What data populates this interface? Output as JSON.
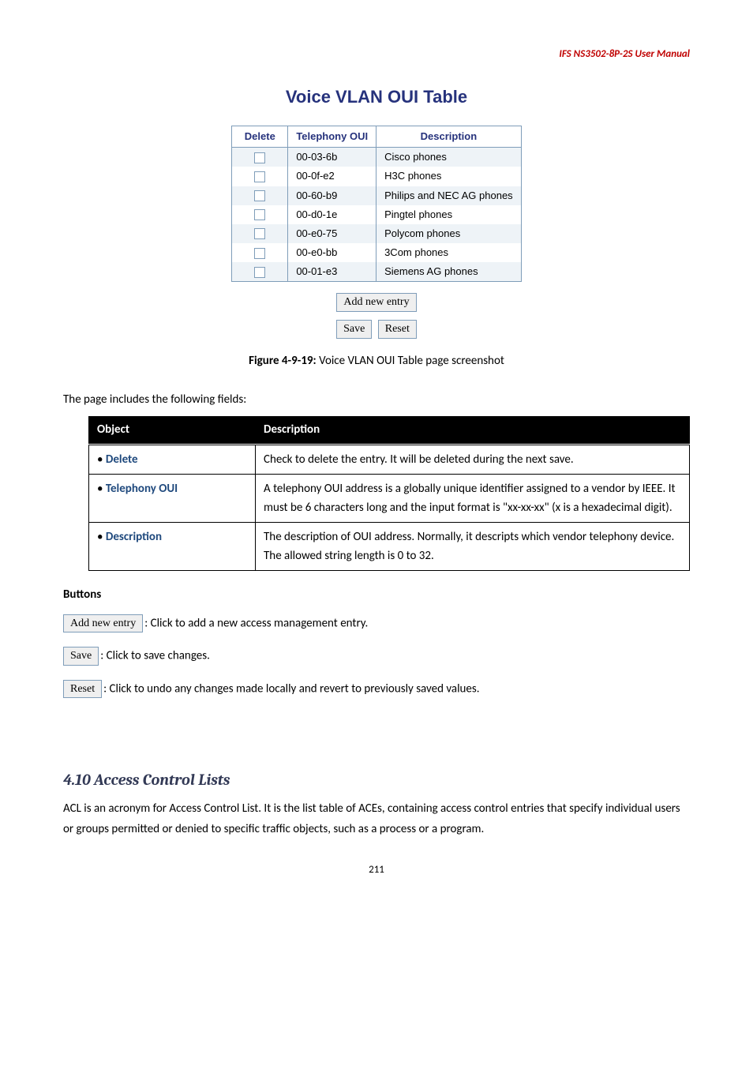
{
  "header": {
    "title": "IFS  NS3502-8P-2S  User  Manual"
  },
  "oui_section": {
    "title": "Voice VLAN OUI Table",
    "columns": {
      "c0": "Delete",
      "c1": "Telephony OUI",
      "c2": "Description"
    },
    "rows": [
      {
        "oui": "00-03-6b",
        "desc": "Cisco phones"
      },
      {
        "oui": "00-0f-e2",
        "desc": "H3C phones"
      },
      {
        "oui": "00-60-b9",
        "desc": "Philips and NEC AG phones"
      },
      {
        "oui": "00-d0-1e",
        "desc": "Pingtel phones"
      },
      {
        "oui": "00-e0-75",
        "desc": "Polycom phones"
      },
      {
        "oui": "00-e0-bb",
        "desc": "3Com phones"
      },
      {
        "oui": "00-01-e3",
        "desc": "Siemens AG phones"
      }
    ],
    "add_btn": "Add new entry",
    "save_btn": "Save",
    "reset_btn": "Reset"
  },
  "figure_caption": {
    "label": "Figure 4-9-19:",
    "text": " Voice VLAN OUI Table page screenshot"
  },
  "fields_intro": "The page includes the following fields:",
  "desc_table": {
    "headers": {
      "obj": "Object",
      "desc": "Description"
    },
    "rows": {
      "r0": {
        "label": "Delete",
        "text": "Check to delete the entry. It will be deleted during the next save."
      },
      "r1": {
        "label": "Telephony OUI",
        "text": "A telephony OUI address is a globally unique identifier assigned to a vendor by IEEE. It must be 6 characters long and the input format is \"xx-xx-xx\" (x is a hexadecimal digit)."
      },
      "r2": {
        "label": "Description",
        "text": "The description of OUI address. Normally, it descripts which vendor telephony device. The allowed string length is 0 to 32."
      }
    }
  },
  "buttons_section": {
    "heading": "Buttons",
    "lines": {
      "l0": {
        "btn": "Add new entry",
        "text": ": Click to add a new access management entry."
      },
      "l1": {
        "btn": "Save",
        "text": ": Click to save changes."
      },
      "l2": {
        "btn": "Reset",
        "text": ": Click to undo any changes made locally and revert to previously saved values."
      }
    }
  },
  "section_410": {
    "heading": "4.10 Access Control Lists",
    "body": "ACL is an acronym for Access Control List. It is the list table of ACEs, containing access control entries that specify individual users or groups permitted or denied to specific traffic objects, such as a process or a program."
  },
  "page_number": "211"
}
